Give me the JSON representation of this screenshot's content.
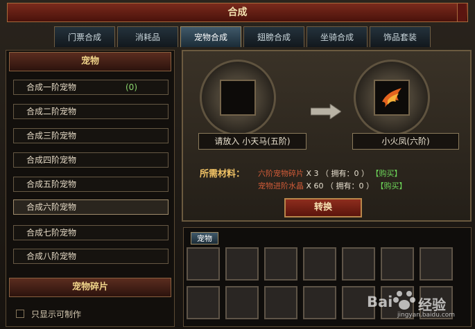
{
  "window": {
    "title": "合成"
  },
  "tabs": [
    {
      "label": "门票合成"
    },
    {
      "label": "消耗品"
    },
    {
      "label": "宠物合成"
    },
    {
      "label": "翅膀合成"
    },
    {
      "label": "坐骑合成"
    },
    {
      "label": "饰品套装"
    }
  ],
  "sidebar": {
    "section1": "宠物",
    "items": [
      {
        "label": "合成一阶宠物",
        "count": "(0)"
      },
      {
        "label": "合成二阶宠物"
      },
      {
        "label": "合成三阶宠物"
      },
      {
        "label": "合成四阶宠物"
      },
      {
        "label": "合成五阶宠物"
      },
      {
        "label": "合成六阶宠物"
      },
      {
        "label": "合成七阶宠物"
      },
      {
        "label": "合成八阶宠物"
      }
    ],
    "section2": "宠物碎片",
    "checkbox_label": "只显示可制作"
  },
  "synthesis": {
    "input_label": "请放入 小天马(五阶)",
    "output_label": "小火凤(六阶)",
    "requirements_title": "所需材料：",
    "materials": [
      {
        "name": "六阶宠物碎片",
        "qty": "X 3 （ 拥有：0 ）",
        "buy": "【购买】"
      },
      {
        "name": "宠物进阶水晶",
        "qty": "X 60 （ 拥有：0 ）",
        "buy": "【购买】"
      }
    ],
    "convert_button": "转换"
  },
  "inventory": {
    "tab_label": "宠物"
  },
  "watermark": {
    "text1": "Bai",
    "text2": "经验",
    "url": "jingyan.baidu.com"
  },
  "colors": {
    "accent_gold": "#f0c265",
    "material_red": "#d05b38",
    "buy_green": "#6cd458"
  }
}
